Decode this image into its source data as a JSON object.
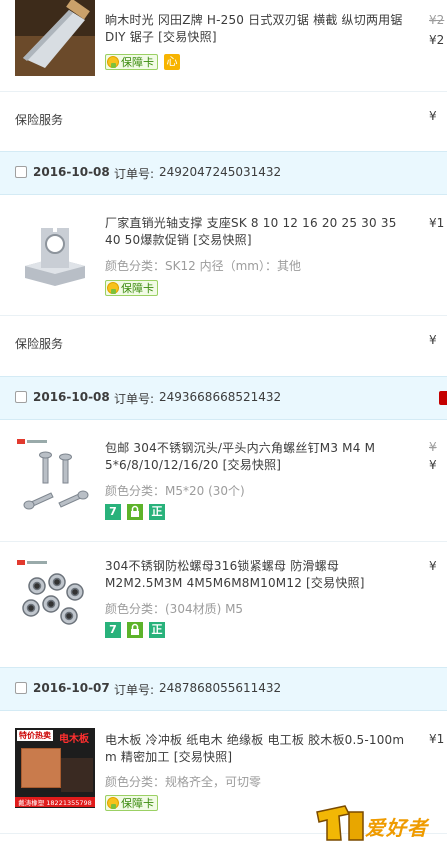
{
  "items": [
    {
      "title": "晌木时光 冈田Z牌 H-250 日式双刃锯 横截 纵切两用锯 DIY 锯子",
      "snapshot": "[交易快照]",
      "badge_label": "保障卡",
      "heart_label": "心",
      "price_orig": "¥2",
      "price_now": "¥2"
    },
    {
      "title": "厂家直销光轴支撑 支座SK 8 10 12 16 20 25 30 35 40 50爆款促销",
      "snapshot": "[交易快照]",
      "spec": "颜色分类：SK12  内径（mm）：其他",
      "badge_label": "保障卡",
      "price_now": "¥1"
    },
    {
      "title": "包邮 304不锈钢沉头/平头内六角螺丝钉M3 M4 M 5*6/8/10/12/16/20",
      "snapshot": "[交易快照]",
      "spec": "颜色分类：M5*20 (30个)",
      "price_orig": "¥",
      "price_now": "¥",
      "icon_labels": [
        "7",
        "正"
      ]
    },
    {
      "title": "304不锈钢防松螺母316锁紧螺母 防滑螺母M2M2.5M3M 4M5M6M8M10M12",
      "snapshot": "[交易快照]",
      "spec": "颜色分类：(304材质) M5",
      "price_now": "¥",
      "icon_labels": [
        "7",
        "正"
      ]
    },
    {
      "title": "电木板 冷冲板 纸电木 绝缘板 电工板 胶木板0.5-100m m 精密加工",
      "snapshot": "[交易快照]",
      "spec": "颜色分类：规格齐全，可切零",
      "badge_label": "保障卡",
      "price_now": "¥1",
      "thumb_text": [
        "特价热卖",
        "电木板",
        "戴涛橡塑 18221355798"
      ]
    }
  ],
  "insurance_label": "保险服务",
  "insurance_price": [
    "¥",
    "¥"
  ],
  "orders": [
    {
      "date": "2016-10-08",
      "order_no_label": "订单号:",
      "order_no": "2492047245031432"
    },
    {
      "date": "2016-10-08",
      "order_no_label": "订单号:",
      "order_no": "2493668668521432"
    },
    {
      "date": "2016-10-07",
      "order_no_label": "订单号:",
      "order_no": "2487868055611432"
    }
  ],
  "watermark": "爱好者",
  "colors": {
    "header_bg": "#eaf8fe",
    "spec_gray": "#9c9c9c",
    "badge_green": "#3b8b0e",
    "sq_green": "#29b27b"
  }
}
